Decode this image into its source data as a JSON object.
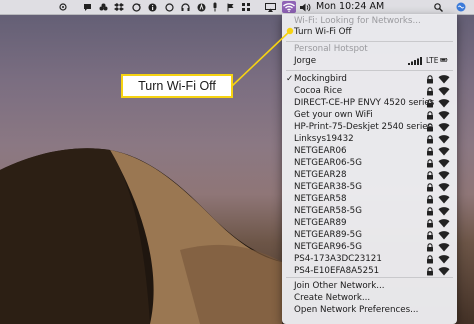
{
  "menubar": {
    "time": "Mon 10:24 AM",
    "icons": [
      "extension-icon",
      "message-icon",
      "flower-icon",
      "dropbox-icon",
      "sync-icon",
      "info-icon",
      "circle-icon",
      "headphones-icon",
      "adobe-icon",
      "microphone-icon",
      "flag-icon",
      "airplay-icon",
      "wifi-icon",
      "volume-icon",
      "search-icon",
      "siri-icon"
    ]
  },
  "wifi_menu": {
    "status": "Wi-Fi: Looking for Networks...",
    "turn_off": "Turn Wi-Fi Off",
    "hotspot_header": "Personal Hotspot",
    "hotspot_name": "Jorge",
    "hotspot_network_type": "LTE",
    "networks": [
      {
        "name": "Mockingbird",
        "checked": true
      },
      {
        "name": "Cocoa Rice"
      },
      {
        "name": "DIRECT-CE-HP ENVY 4520 series"
      },
      {
        "name": "Get your own WiFi"
      },
      {
        "name": "HP-Print-75-Deskjet 2540 series"
      },
      {
        "name": "Linksys19432"
      },
      {
        "name": "NETGEAR06"
      },
      {
        "name": "NETGEAR06-5G"
      },
      {
        "name": "NETGEAR28"
      },
      {
        "name": "NETGEAR38-5G"
      },
      {
        "name": "NETGEAR58"
      },
      {
        "name": "NETGEAR58-5G"
      },
      {
        "name": "NETGEAR89"
      },
      {
        "name": "NETGEAR89-5G"
      },
      {
        "name": "NETGEAR96-5G"
      },
      {
        "name": "PS4-173A3DC23121"
      },
      {
        "name": "PS4-E10EFA8A5251"
      }
    ],
    "footer": [
      "Join Other Network...",
      "Create Network...",
      "Open Network Preferences..."
    ]
  },
  "callout": {
    "text": "Turn Wi-Fi Off",
    "border_color": "#f6d312"
  },
  "colors": {
    "wifi_highlight": "#8f63b6",
    "menu_bg": "#ececef"
  }
}
